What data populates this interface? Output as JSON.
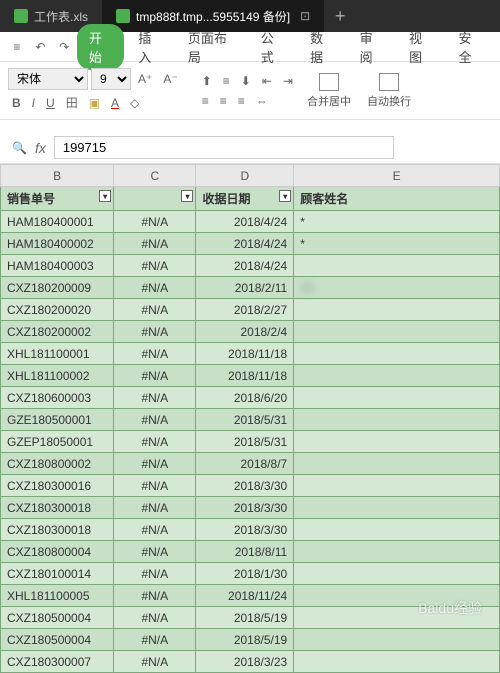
{
  "tabs": [
    {
      "label": "工作表.xls",
      "active": false
    },
    {
      "label": "tmp888f.tmp...5955149 备份]",
      "active": true
    }
  ],
  "menu": {
    "items": [
      "开始",
      "插入",
      "页面布局",
      "公式",
      "数据",
      "审阅",
      "视图",
      "安全"
    ],
    "active_index": 0
  },
  "ribbon": {
    "font": "宋体",
    "size": "9",
    "merge": "合并居中",
    "wrap": "自动换行"
  },
  "formula_bar": {
    "value": "199715"
  },
  "columns": [
    "B",
    "C",
    "D",
    "E"
  ],
  "headers": {
    "b": "销售单号",
    "c": "",
    "d": "收据日期",
    "e": "顾客姓名"
  },
  "rows": [
    {
      "b": "HAM180400001",
      "c": "#N/A",
      "d": "2018/4/24",
      "e": "*"
    },
    {
      "b": "HAM180400002",
      "c": "#N/A",
      "d": "2018/4/24",
      "e": "*"
    },
    {
      "b": "HAM180400003",
      "c": "#N/A",
      "d": "2018/4/24",
      "e": ""
    },
    {
      "b": "CXZ180200009",
      "c": "#N/A",
      "d": "2018/2/11",
      "e": "   15"
    },
    {
      "b": "CXZ180200020",
      "c": "#N/A",
      "d": "2018/2/27",
      "e": ""
    },
    {
      "b": "CXZ180200002",
      "c": "#N/A",
      "d": "2018/2/4",
      "e": ""
    },
    {
      "b": "XHL181100001",
      "c": "#N/A",
      "d": "2018/11/18",
      "e": ""
    },
    {
      "b": "XHL181100002",
      "c": "#N/A",
      "d": "2018/11/18",
      "e": ""
    },
    {
      "b": "CXZ180600003",
      "c": "#N/A",
      "d": "2018/6/20",
      "e": ""
    },
    {
      "b": "GZE180500001",
      "c": "#N/A",
      "d": "2018/5/31",
      "e": ""
    },
    {
      "b": "GZEP18050001",
      "c": "#N/A",
      "d": "2018/5/31",
      "e": ""
    },
    {
      "b": "CXZ180800002",
      "c": "#N/A",
      "d": "2018/8/7",
      "e": ""
    },
    {
      "b": "CXZ180300016",
      "c": "#N/A",
      "d": "2018/3/30",
      "e": ""
    },
    {
      "b": "CXZ180300018",
      "c": "#N/A",
      "d": "2018/3/30",
      "e": ""
    },
    {
      "b": "CXZ180300018",
      "c": "#N/A",
      "d": "2018/3/30",
      "e": ""
    },
    {
      "b": "CXZ180800004",
      "c": "#N/A",
      "d": "2018/8/11",
      "e": ""
    },
    {
      "b": "CXZ180100014",
      "c": "#N/A",
      "d": "2018/1/30",
      "e": ""
    },
    {
      "b": "XHL181100005",
      "c": "#N/A",
      "d": "2018/11/24",
      "e": ""
    },
    {
      "b": "CXZ180500004",
      "c": "#N/A",
      "d": "2018/5/19",
      "e": ""
    },
    {
      "b": "CXZ180500004",
      "c": "#N/A",
      "d": "2018/5/19",
      "e": ""
    },
    {
      "b": "CXZ180300007",
      "c": "#N/A",
      "d": "2018/3/23",
      "e": ""
    }
  ],
  "watermark": "Baidu经验"
}
